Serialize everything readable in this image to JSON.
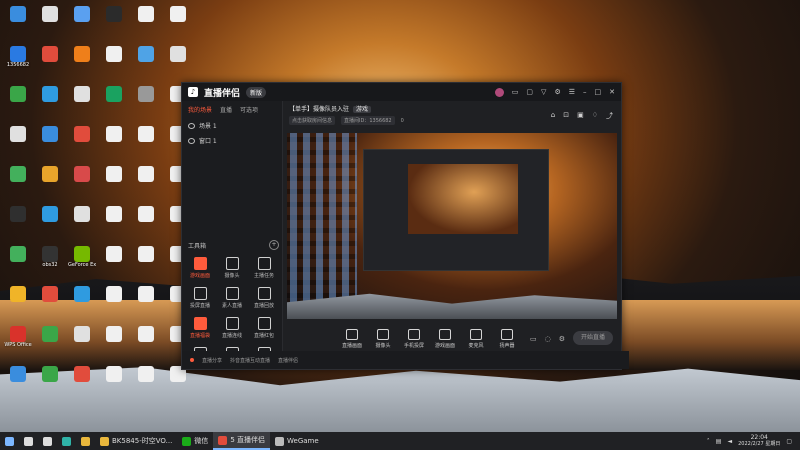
{
  "desktop": {
    "icons": [
      {
        "label": "",
        "color": "#3a8dde"
      },
      {
        "label": "",
        "color": "#e0e0e0"
      },
      {
        "label": "",
        "color": "#5aa0f0"
      },
      {
        "label": "",
        "color": "#2b2b2b"
      },
      {
        "label": "",
        "color": "#f0f0f0"
      },
      {
        "label": "",
        "color": "#f0f0f0"
      },
      {
        "label": "1356682",
        "color": "#2a7ae2"
      },
      {
        "label": "",
        "color": "#e14c3c"
      },
      {
        "label": "",
        "color": "#ef7f1a"
      },
      {
        "label": "",
        "color": "#f0f0f0"
      },
      {
        "label": "",
        "color": "#4fa3e6"
      },
      {
        "label": "",
        "color": "#e0e0e0"
      },
      {
        "label": "",
        "color": "#3aa648"
      },
      {
        "label": "",
        "color": "#2f9be0"
      },
      {
        "label": "",
        "color": "#e0e0e0"
      },
      {
        "label": "",
        "color": "#1aa260"
      },
      {
        "label": "",
        "color": "#999"
      },
      {
        "label": "",
        "color": "#f0f0f0"
      },
      {
        "label": "",
        "color": "#e0e0e0"
      },
      {
        "label": "",
        "color": "#3a8dde"
      },
      {
        "label": "",
        "color": "#e14c3c"
      },
      {
        "label": "",
        "color": "#f0f0f0"
      },
      {
        "label": "",
        "color": "#f0f0f0"
      },
      {
        "label": "",
        "color": "#f0f0f0"
      },
      {
        "label": "",
        "color": "#43b05c"
      },
      {
        "label": "",
        "color": "#e8a42b"
      },
      {
        "label": "",
        "color": "#d84a4a"
      },
      {
        "label": "",
        "color": "#f0f0f0"
      },
      {
        "label": "",
        "color": "#f0f0f0"
      },
      {
        "label": "",
        "color": "#f0f0f0"
      },
      {
        "label": "",
        "color": "#2f2f2f"
      },
      {
        "label": "",
        "color": "#2f9be0"
      },
      {
        "label": "",
        "color": "#e0e0e0"
      },
      {
        "label": "",
        "color": "#f0f0f0"
      },
      {
        "label": "",
        "color": "#f0f0f0"
      },
      {
        "label": "",
        "color": "#f0f0f0"
      },
      {
        "label": "",
        "color": "#43b05c"
      },
      {
        "label": "obs32",
        "color": "#333"
      },
      {
        "label": "GeForce Experience",
        "color": "#76b900"
      },
      {
        "label": "",
        "color": "#f0f0f0"
      },
      {
        "label": "",
        "color": "#f0f0f0"
      },
      {
        "label": "",
        "color": "#f0f0f0"
      },
      {
        "label": "",
        "color": "#f0b428"
      },
      {
        "label": "",
        "color": "#e14c3c"
      },
      {
        "label": "",
        "color": "#2f9be0"
      },
      {
        "label": "",
        "color": "#f0f0f0"
      },
      {
        "label": "",
        "color": "#f0f0f0"
      },
      {
        "label": "",
        "color": "#f0f0f0"
      },
      {
        "label": "WPS Office",
        "color": "#d9322b"
      },
      {
        "label": "",
        "color": "#3aa648"
      },
      {
        "label": "",
        "color": "#e0e0e0"
      },
      {
        "label": "",
        "color": "#f0f0f0"
      },
      {
        "label": "",
        "color": "#f0f0f0"
      },
      {
        "label": "",
        "color": "#f0f0f0"
      },
      {
        "label": "",
        "color": "#3a8dde"
      },
      {
        "label": "",
        "color": "#3aa648"
      },
      {
        "label": "",
        "color": "#e14c3c"
      },
      {
        "label": "",
        "color": "#f0f0f0"
      },
      {
        "label": "",
        "color": "#f0f0f0"
      },
      {
        "label": "",
        "color": "#f0f0f0"
      }
    ]
  },
  "window": {
    "app_name": "直播伴侣",
    "version_badge": "新版",
    "title_icons": [
      "avatar",
      "chat-icon",
      "box-icon",
      "shirt-icon",
      "settings-icon",
      "menu-icon",
      "minimize-icon",
      "maximize-icon",
      "close-icon"
    ],
    "left_tabs": [
      "我的场景",
      "直播",
      "可选项"
    ],
    "scenes": [
      {
        "name": "场景 1"
      },
      {
        "name": "窗口 1"
      }
    ],
    "tools_header": "工具箱",
    "tools": [
      {
        "label": "游戏画面",
        "active": true
      },
      {
        "label": "摄像头",
        "active": false
      },
      {
        "label": "主播任务",
        "active": false
      },
      {
        "label": "投屏直播",
        "active": false
      },
      {
        "label": "素人直播",
        "active": false
      },
      {
        "label": "直播回放",
        "active": false
      },
      {
        "label": "直播福袋",
        "active": true
      },
      {
        "label": "直播连线",
        "active": false
      },
      {
        "label": "直播红包",
        "active": false
      },
      {
        "label": "",
        "active": false
      },
      {
        "label": "",
        "active": false
      },
      {
        "label": "",
        "active": false
      }
    ],
    "room": {
      "title": "【单手】摄像队员入驻",
      "tag": "游戏",
      "line_items": [
        "点击获取房间信息",
        "直播间ID：1356682"
      ],
      "online_count": "0"
    },
    "right_top_icons": [
      "gift-icon",
      "lock-icon",
      "save-icon",
      "bell-icon",
      "share-icon"
    ],
    "bottom_buttons": [
      {
        "label": "直播画面",
        "icon": "screen-icon"
      },
      {
        "label": "摄像头",
        "icon": "camera-icon"
      },
      {
        "label": "手机投屏",
        "icon": "phone-icon"
      },
      {
        "label": "游戏画面",
        "icon": "game-icon"
      },
      {
        "label": "麦克风",
        "icon": "mic-icon"
      },
      {
        "label": "扬声器",
        "icon": "speaker-icon"
      }
    ],
    "go_live_label": "开始直播",
    "status_items": [
      "直播分享",
      "抖音直播互动直播",
      "直播伴侣"
    ]
  },
  "taskbar": {
    "items": [
      {
        "label": "",
        "icon": "windows-start-icon",
        "color": "#7cb7ff"
      },
      {
        "label": "",
        "icon": "search-icon",
        "color": "#ddd"
      },
      {
        "label": "",
        "icon": "task-view-icon",
        "color": "#ddd"
      },
      {
        "label": "",
        "icon": "edge-icon",
        "color": "#2fb3a8"
      },
      {
        "label": "",
        "icon": "explorer-icon",
        "color": "#e9b73c"
      },
      {
        "label": "BK5845-时空VO...",
        "icon": "folder-icon",
        "color": "#e9b73c"
      },
      {
        "label": "微信",
        "icon": "wechat-icon",
        "color": "#1aad19"
      },
      {
        "label": "5 直播伴侣",
        "icon": "douyin-icon",
        "color": "#e14c3c",
        "active": true
      },
      {
        "label": "WeGame",
        "icon": "wegame-icon",
        "color": "#bbb"
      }
    ],
    "tray": {
      "time": "22:04",
      "date": "2022/2/27 星期日"
    }
  }
}
